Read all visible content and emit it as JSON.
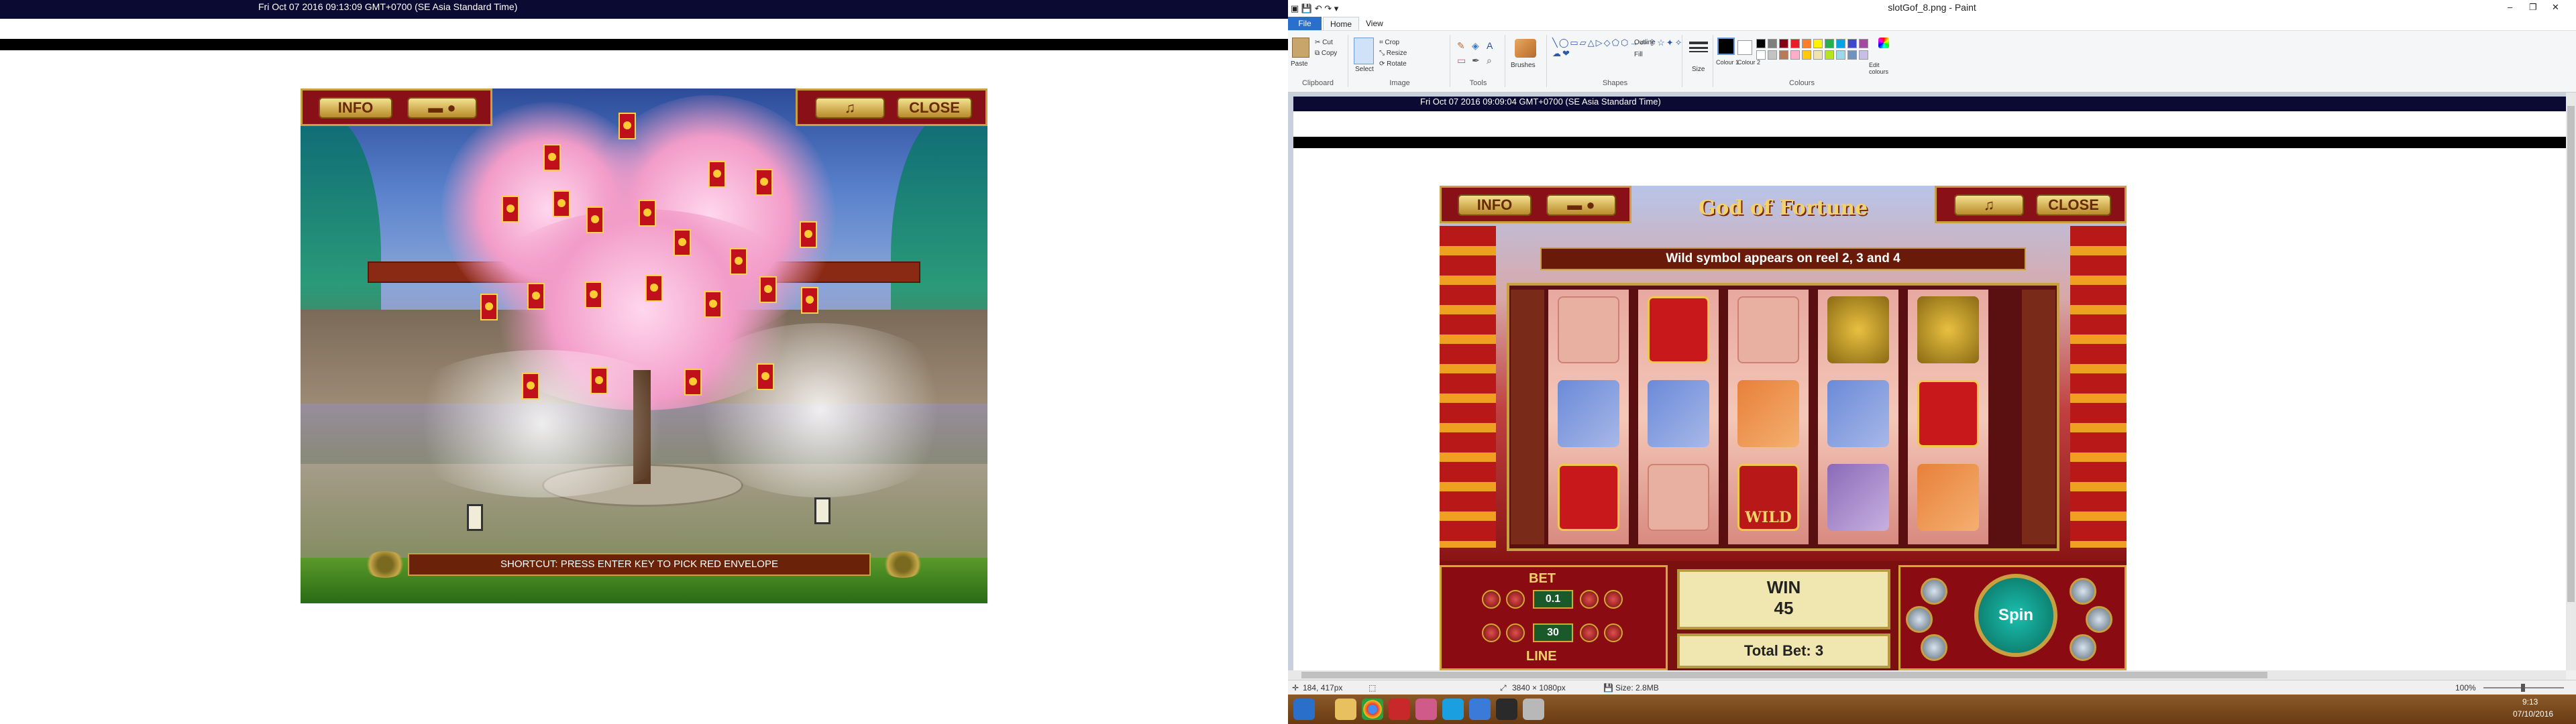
{
  "left_screen": {
    "timestamp": "Fri Oct 07 2016 09:13:09 GMT+0700 (SE Asia Standard Time)",
    "game": {
      "buttons": {
        "info": "INFO",
        "close": "CLOSE"
      },
      "shortcut_text": "SHORTCUT: PRESS ENTER KEY TO PICK RED ENVELOPE",
      "envelope_count": 22
    }
  },
  "paint": {
    "title": "slotGof_8.png - Paint",
    "menu": {
      "file": "File",
      "home": "Home",
      "view": "View"
    },
    "ribbon": {
      "clipboard": {
        "label": "Clipboard",
        "paste": "Paste",
        "cut": "Cut",
        "copy": "Copy"
      },
      "image": {
        "label": "Image",
        "select": "Select",
        "crop": "Crop",
        "resize": "Resize",
        "rotate": "Rotate"
      },
      "tools": {
        "label": "Tools"
      },
      "brushes": "Brushes",
      "shapes": {
        "label": "Shapes",
        "outline": "Outline",
        "fill": "Fill"
      },
      "size": "Size",
      "colour1": "Colour 1",
      "colour2": "Colour 2",
      "colours": {
        "label": "Colours",
        "edit": "Edit colours"
      }
    },
    "palette": [
      "#000000",
      "#7f7f7f",
      "#880015",
      "#ed1c24",
      "#ff7f27",
      "#fff200",
      "#22b14c",
      "#00a2e8",
      "#3f48cc",
      "#a349a4",
      "#ffffff",
      "#c3c3c3",
      "#b97a57",
      "#ffaec9",
      "#ffc90e",
      "#efe4b0",
      "#b5e61d",
      "#99d9ea",
      "#7092be",
      "#c8bfe7"
    ],
    "status": {
      "cursor_pos": "184, 417px",
      "dimensions": "3840 × 1080px",
      "size": "Size: 2.8MB",
      "zoom": "100%"
    },
    "screenshot": {
      "timestamp": "Fri Oct 07 2016 09:09:04 GMT+0700 (SE Asia Standard Time)",
      "game": {
        "logo": "God of Fortune",
        "buttons": {
          "info": "INFO",
          "close": "CLOSE"
        },
        "banner": "Wild symbol appears on reel 2, 3 and 4",
        "wild_label": "WILD",
        "bet_label": "BET",
        "bet_value": "0.1",
        "lines_value": "30",
        "line_label": "LINE",
        "win_label": "WIN",
        "win_value": "45",
        "total_bet": "Total Bet: 3",
        "spin_label": "Spin"
      }
    }
  },
  "taskbar": {
    "time": "9:13",
    "date": "07/10/2016"
  }
}
